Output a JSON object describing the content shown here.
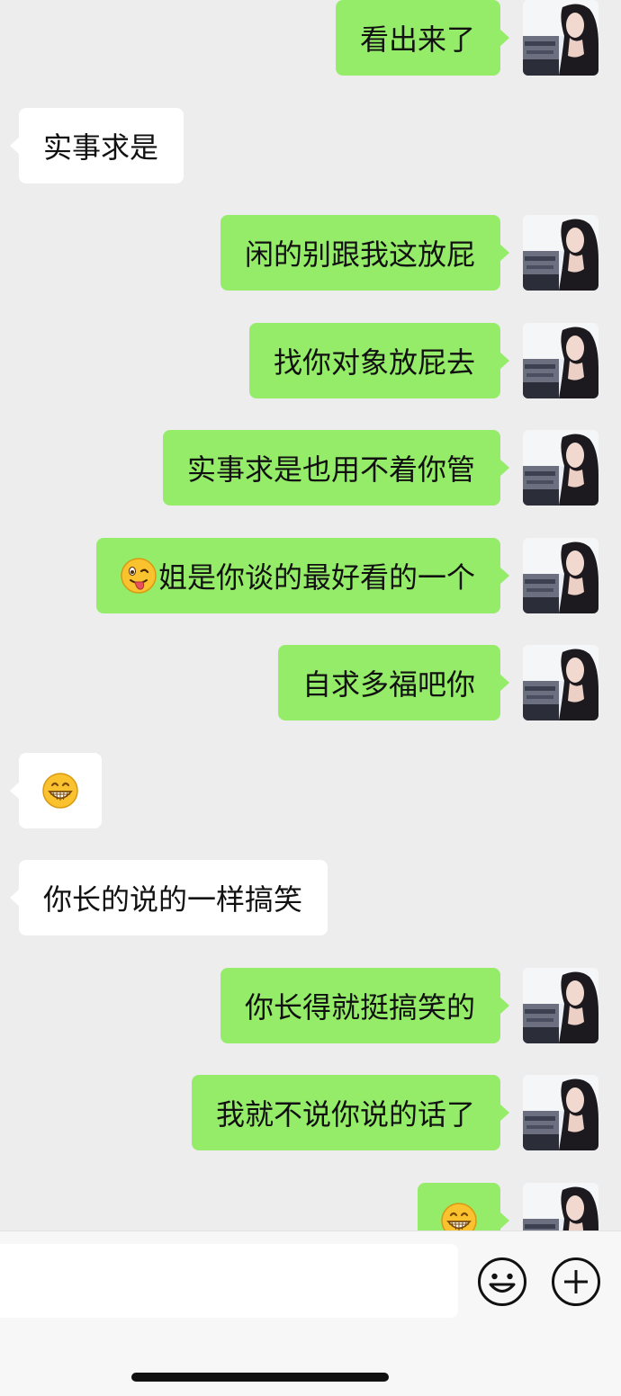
{
  "messages": [
    {
      "side": "out",
      "text": "看出来了"
    },
    {
      "side": "in",
      "text": "实事求是"
    },
    {
      "side": "out",
      "text": "闲的别跟我这放屁"
    },
    {
      "side": "out",
      "text": "找你对象放屁去"
    },
    {
      "side": "out",
      "text": "实事求是也用不着你管"
    },
    {
      "side": "out",
      "text": "姐是你谈的最好看的一个",
      "emoji": "wink-tongue-emoji"
    },
    {
      "side": "out",
      "text": "自求多福吧你"
    },
    {
      "side": "in",
      "text": "",
      "emoji": "grin-emoji"
    },
    {
      "side": "in",
      "text": "你长的说的一样搞笑"
    },
    {
      "side": "out",
      "text": "你长得就挺搞笑的"
    },
    {
      "side": "out",
      "text": "我就不说你说的话了"
    },
    {
      "side": "out",
      "text": "",
      "emoji": "grin-emoji"
    }
  ],
  "input_bar": {
    "input_value": "",
    "emoji_button_icon": "smiley-icon",
    "more_button_icon": "plus-circle-icon"
  },
  "colors": {
    "outgoing_bubble": "#95ec69",
    "incoming_bubble": "#ffffff",
    "background": "#ededed"
  }
}
